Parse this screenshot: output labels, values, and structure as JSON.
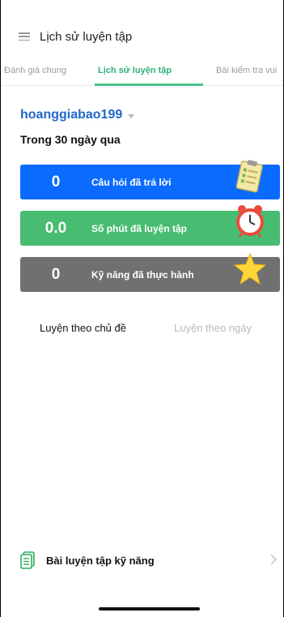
{
  "header": {
    "title": "Lịch sử luyện tập",
    "menu_icon": "hamburger-icon"
  },
  "tabs": [
    {
      "label": "Đánh giá chung",
      "active": false
    },
    {
      "label": "Lịch sử luyện tập",
      "active": true
    },
    {
      "label": "Bài kiểm tra vui",
      "active": false
    }
  ],
  "user": {
    "name": "hoanggiabao199",
    "dropdown_icon": "caret-down-icon"
  },
  "period": "Trong 30 ngày qua",
  "stats": [
    {
      "value": "0",
      "label": "Câu hỏi đã trả lời",
      "color": "#0c6bff",
      "icon": "clipboard-checklist-icon"
    },
    {
      "value": "0.0",
      "label": "Số phút đã luyện tập",
      "color": "#48bd72",
      "icon": "alarm-clock-icon"
    },
    {
      "value": "0",
      "label": "Kỹ năng đã thực hành",
      "color": "#707070",
      "icon": "star-icon"
    }
  ],
  "subtabs": [
    {
      "label": "Luyện theo chủ đề",
      "active": true
    },
    {
      "label": "Luyện theo ngày",
      "active": false
    }
  ],
  "bottom_item": {
    "label": "Bài luyện tập kỹ năng",
    "icon": "document-icon",
    "chevron": "chevron-right-icon"
  },
  "colors": {
    "accent_green": "#45c38a",
    "user_blue": "#1f67c8"
  }
}
